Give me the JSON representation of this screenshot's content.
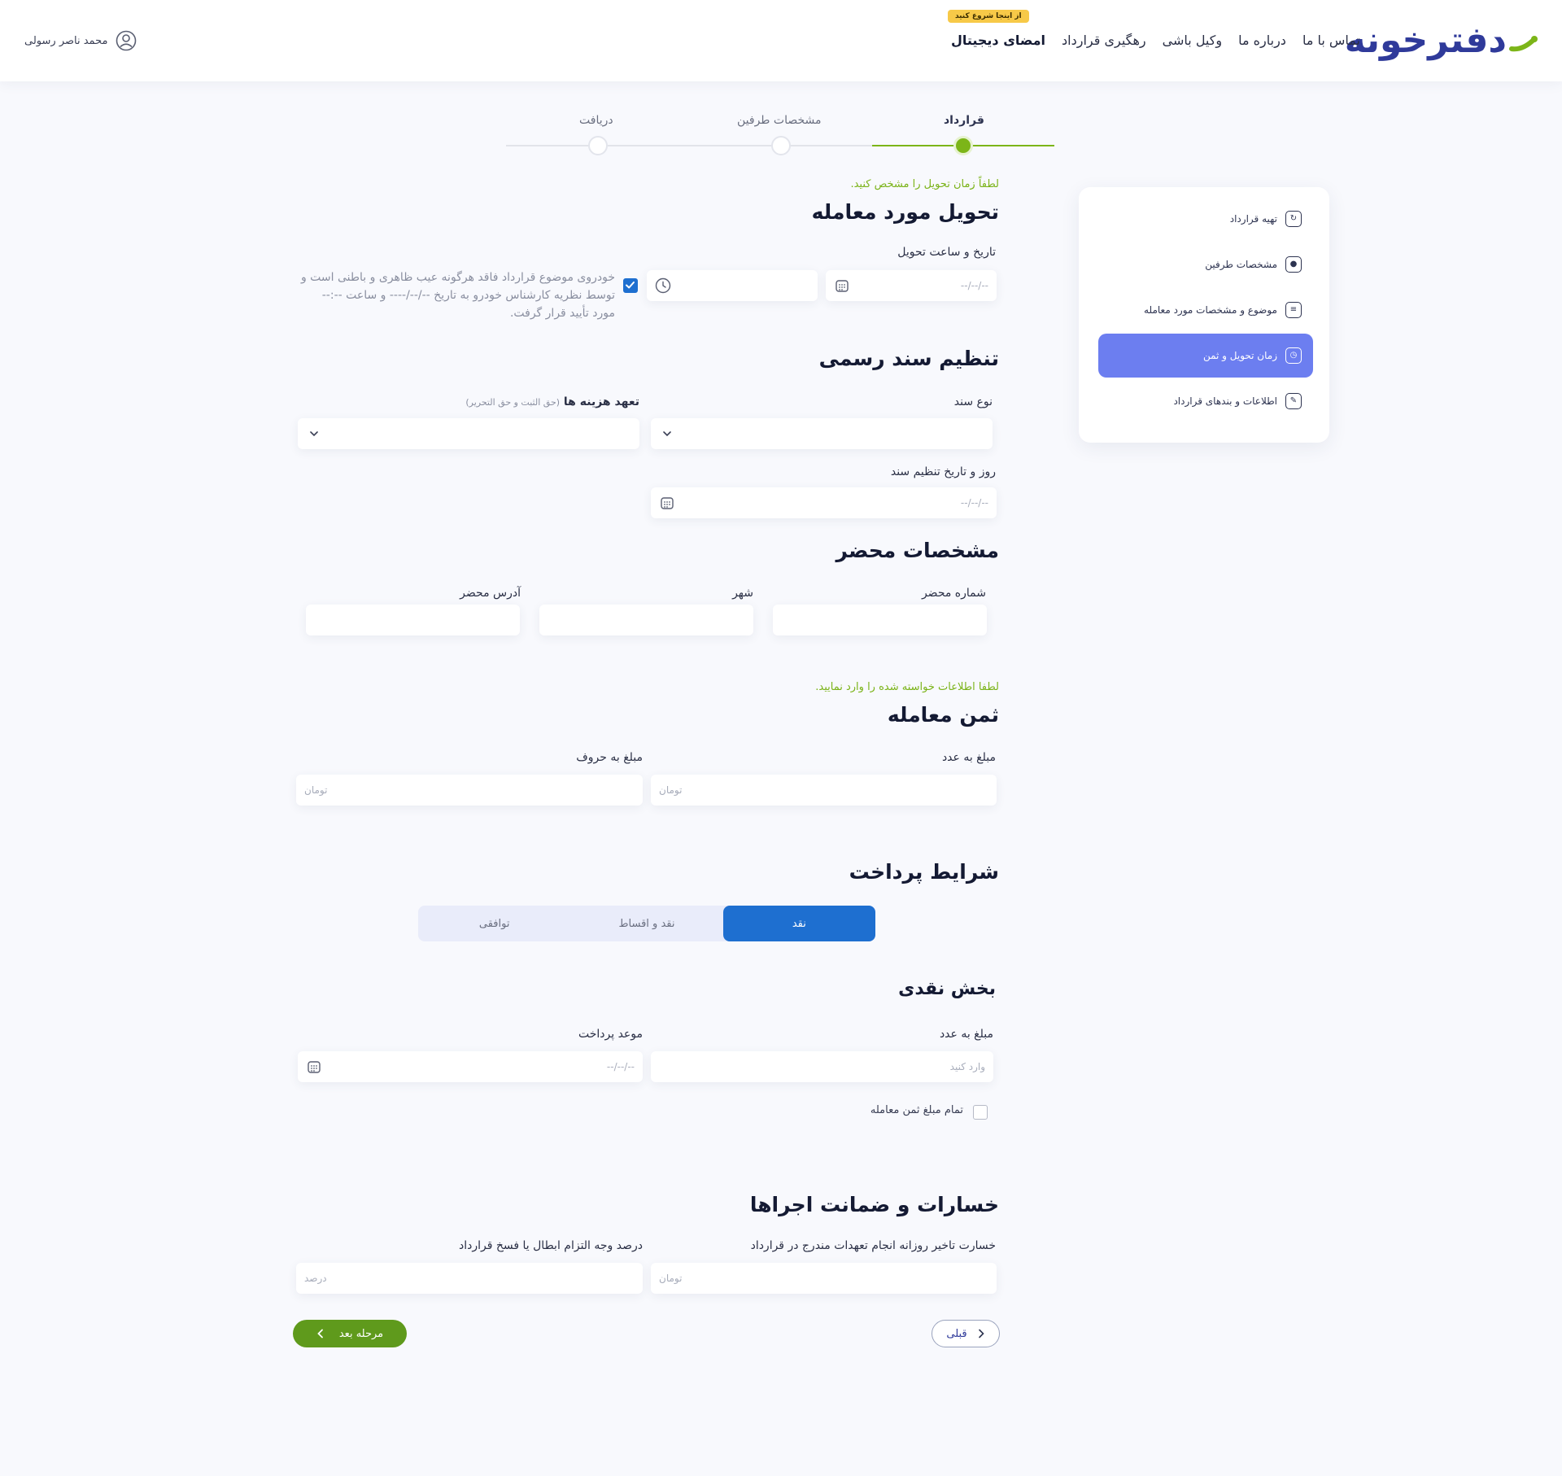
{
  "header": {
    "logo_text": "دفترخونه",
    "nav": [
      {
        "label": "امضای دیجیتال",
        "strong": true
      },
      {
        "label": "رهگیری قرارداد"
      },
      {
        "label": "وکیل باشی"
      },
      {
        "label": "درباره ما"
      },
      {
        "label": "تماس با ما"
      }
    ],
    "start_badge": "از اینجا شروع کنید",
    "user_name": "محمد ناصر رسولی"
  },
  "stepper": {
    "steps": [
      {
        "label": "قرارداد",
        "active": true
      },
      {
        "label": "مشخصات طرفین",
        "active": false
      },
      {
        "label": "دریافت",
        "active": false
      }
    ]
  },
  "sidebar": {
    "items": [
      {
        "label": "تهیه قرارداد",
        "icon": "file-sync-icon"
      },
      {
        "label": "مشخصات طرفین",
        "icon": "user-icon"
      },
      {
        "label": "موضوع و مشخصات مورد معامله",
        "icon": "document-icon"
      },
      {
        "label": "زمان تحویل و ثمن",
        "icon": "clock-icon",
        "active": true
      },
      {
        "label": "اطلاعات و بندهای قرارداد",
        "icon": "edit-icon"
      }
    ]
  },
  "delivery": {
    "hint": "لطفاً زمان تحویل را مشخص کنید.",
    "title": "تحویل مورد معامله",
    "date_time_label": "تاریخ و ساعت تحویل",
    "date_placeholder": "--/--/--",
    "time_placeholder": "",
    "note": "خودروی موضوع قرارداد فاقد هرگونه عیب ظاهری و باطنی است و توسط نظریه کارشناس خودرو به تاریخ --/--/---- و ساعت --:-- مورد تأیید قرار گرفت.",
    "note_checked": true
  },
  "official_doc": {
    "title": "تنظیم سند رسمی",
    "doc_type_label": "نوع سند",
    "cost_label": "تعهد هزینه ها",
    "cost_sublabel": "(حق الثبت و حق التحریر)",
    "doc_date_label": "روز و تاریخ تنظیم سند",
    "doc_date_placeholder": "--/--/--"
  },
  "notary": {
    "title": "مشخصات محضر",
    "number_label": "شماره محضر",
    "city_label": "شهر",
    "address_label": "آدرس محضر"
  },
  "price": {
    "hint": "لطفا اطلاعات خواسته شده را وارد نمایید.",
    "title": "ثمن معامله",
    "amount_number_label": "مبلغ به عدد",
    "amount_words_label": "مبلغ به حروف",
    "amount_number_placeholder": "تومان",
    "amount_words_placeholder": "تومان"
  },
  "payment": {
    "title": "شرایط پرداخت",
    "tabs": [
      {
        "label": "نقد",
        "active": true
      },
      {
        "label": "نقد و اقساط"
      },
      {
        "label": "توافقی"
      }
    ]
  },
  "cash": {
    "title": "بخش نقدی",
    "amount_label": "مبلغ به عدد",
    "amount_placeholder": "وارد کنید",
    "due_label": "موعد پرداخت",
    "due_placeholder": "--/--/--",
    "full_amount_label": "تمام مبلغ ثمن معامله",
    "full_amount_checked": false
  },
  "damages": {
    "title": "خسارات و ضمانت اجراها",
    "daily_label": "خسارت تاخیر روزانه انجام تعهدات مندرج در قرارداد",
    "daily_placeholder": "تومان",
    "percent_label": "درصد وجه التزام ابطال یا فسخ قرارداد",
    "percent_placeholder": "درصد"
  },
  "actions": {
    "prev_label": "قبلی",
    "next_label": "مرحله بعد"
  },
  "colors": {
    "brand": "#2f3a9a",
    "accent_green": "#7cb518",
    "active_sidebar": "#6c7ef0",
    "tab_active": "#1e6fd0"
  }
}
